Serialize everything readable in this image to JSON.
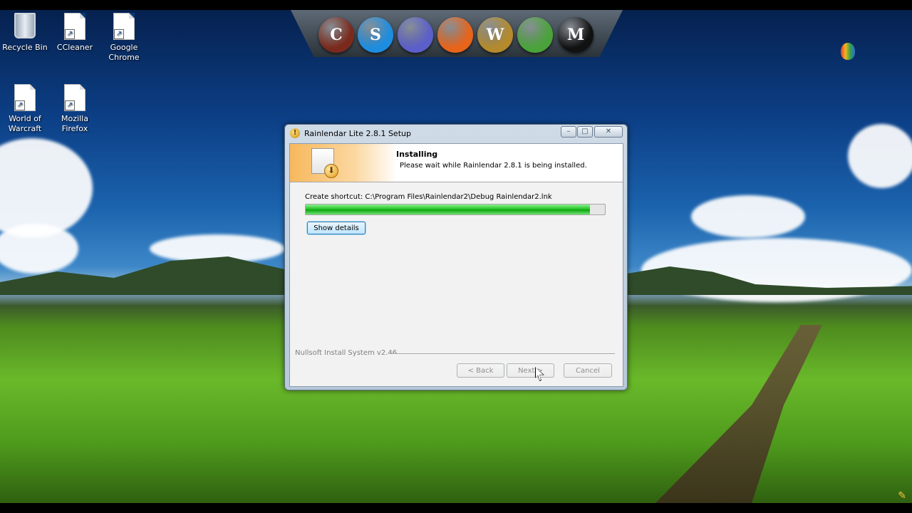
{
  "desktop": {
    "icons": [
      {
        "label": "Recycle Bin",
        "icon": "recycle-bin-icon"
      },
      {
        "label": "CCleaner",
        "icon": "shortcut-icon"
      },
      {
        "label": "Google Chrome",
        "icon": "shortcut-icon"
      },
      {
        "label": "World of Warcraft",
        "icon": "shortcut-icon"
      },
      {
        "label": "Mozilla Firefox",
        "icon": "shortcut-icon"
      }
    ],
    "dock_icons": [
      {
        "name": "ccleaner-dock-icon",
        "glyph": "C",
        "color": "#7a2a1c"
      },
      {
        "name": "skype-dock-icon",
        "glyph": "S",
        "color": "#1d8de0"
      },
      {
        "name": "orb-dock-icon",
        "glyph": "",
        "color": "#5b5fc9"
      },
      {
        "name": "firefox-dock-icon",
        "glyph": "",
        "color": "#e8641a"
      },
      {
        "name": "warcraft-dock-icon",
        "glyph": "W",
        "color": "#b48a2c"
      },
      {
        "name": "messenger-dock-icon",
        "glyph": "",
        "color": "#4aa33a"
      },
      {
        "name": "megaupload-dock-icon",
        "glyph": "M",
        "color": "#111111"
      }
    ]
  },
  "installer": {
    "title": "Rainlendar Lite 2.8.1 Setup",
    "header_title": "Installing",
    "header_subtitle": "Please wait while Rainlendar 2.8.1 is being installed.",
    "status": "Create shortcut: C:\\Program Files\\Rainlendar2\\Debug Rainlendar2.lnk",
    "progress": 0.95,
    "show_details_label": "Show details",
    "branding": "Nullsoft Install System v2.46",
    "back_label": "< Back",
    "next_label": "Next >",
    "cancel_label": "Cancel"
  }
}
